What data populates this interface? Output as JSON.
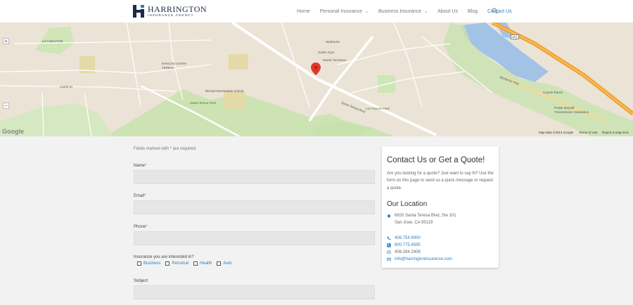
{
  "brand": {
    "name": "HARRINGTON",
    "tagline": "INSURANCE AGENCY",
    "primary_color": "#1e2a4a",
    "accent_color": "#2a7fc1"
  },
  "nav": {
    "items": [
      {
        "label": "Home",
        "has_dropdown": false
      },
      {
        "label": "Personal Insurance",
        "has_dropdown": true
      },
      {
        "label": "Business Insurance",
        "has_dropdown": true
      },
      {
        "label": "About Us",
        "has_dropdown": false
      },
      {
        "label": "Blog",
        "has_dropdown": false
      },
      {
        "label": "Contact Us",
        "has_dropdown": false,
        "active": true
      }
    ],
    "search_icon": "search-icon"
  },
  "map": {
    "labels": {
      "la_colina_park": "La Colina Park",
      "carrie_dr": "Carrie Dr",
      "rancho_santa_teresa": "RANCHO SANTA TERESA",
      "bernal_school": "Bernal Intermediate School",
      "santa_teresa_park": "Santa Teresa Park",
      "starbucks": "Starbucks",
      "golds_gym": "Gold's Gym",
      "sweet_tomatoes": "Sweet Tomatoes",
      "santa_teresa_blvd": "Santa Teresa Blvd",
      "los_paseos_park": "Los Paseos Park",
      "coyote_ranch": "Coyote Ranch",
      "pge": "PG&E Metcalf Transmission Substation",
      "hwy_101": "101",
      "monterey_hwy": "Monterey Hwy"
    },
    "footer": {
      "map_data": "Map data ©2014 Google",
      "terms": "Terms of Use",
      "report": "Report a map error"
    },
    "google": "Google",
    "zoom_in": "+",
    "zoom_out": "−"
  },
  "form": {
    "note": "Fields marked with * are required",
    "fields": {
      "name": "Name",
      "email": "Email",
      "phone": "Phone",
      "subject": "Subject"
    },
    "required_mark": "*",
    "insurance_question": "Insurance you are interested in?",
    "insurance_options": [
      "Business",
      "Personal",
      "Health",
      "Auto"
    ]
  },
  "sidebar": {
    "title": "Contact Us or Get a Quote!",
    "description": "Are you looking for a quote? Just want to say hi? Use the form on this page to send us a quick message or request a quote.",
    "location_heading": "Our Location",
    "address_line1": "6920 Santa Teresa Blvd, Ste 101",
    "address_line2": "San Jose, CA 95119",
    "phone": "408.754.9000",
    "tollfree": "800.775.4595",
    "fax": "408.284.2408",
    "email": "info@harringtoninsurance.com"
  }
}
